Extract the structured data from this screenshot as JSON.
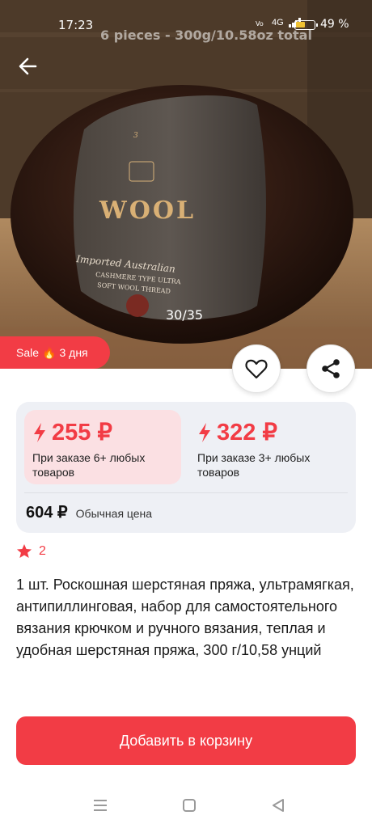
{
  "status_bar": {
    "time": "17:23",
    "network_label": "4G",
    "battery_percent": "49 %"
  },
  "hero": {
    "overlay_caption": "6 pieces - 300g/10.58oz total",
    "label_brand": "WOOL",
    "label_line1": "Imported Australian",
    "label_line2": "CASHMERE TYPE ULTRA",
    "label_line3": "SOFT WOOL THREAD",
    "image_counter": "30/35"
  },
  "sale_badge": {
    "label": "Sale",
    "days": "3 дня"
  },
  "price_card": {
    "tiers": [
      {
        "price": "255 ₽",
        "condition": "При заказе 6+ любых товаров"
      },
      {
        "price": "322 ₽",
        "condition": "При заказе 3+ любых товаров"
      }
    ],
    "regular_price": "604 ₽",
    "regular_label": "Обычная цена"
  },
  "rating": {
    "count": "2"
  },
  "product": {
    "title": "1 шт. Роскошная шерстяная пряжа, ультрамягкая, антипиллинговая, набор для самостоятельного вязания крючком и ручного вязания, теплая и удобная шерстяная пряжа, 300 г/10,58 унций"
  },
  "cart_button": {
    "label": "Добавить в корзину"
  },
  "colors": {
    "accent": "#f23c45",
    "tier_highlight": "#fbe0e3",
    "card_background": "#eef0f5"
  }
}
